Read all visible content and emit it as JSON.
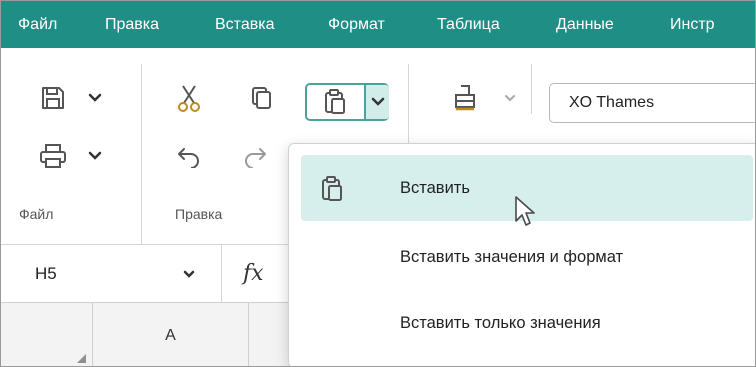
{
  "menubar": {
    "items": [
      "Файл",
      "Правка",
      "Вставка",
      "Формат",
      "Таблица",
      "Данные",
      "Инстр"
    ]
  },
  "toolbar": {
    "groups": {
      "file": "Файл",
      "edit": "Правка"
    },
    "font_name": "XO Thames"
  },
  "formula_bar": {
    "cell_reference": "H5",
    "fx_label": "fx"
  },
  "grid": {
    "column_headers": [
      "A"
    ]
  },
  "paste_menu": {
    "items": [
      {
        "label": "Вставить",
        "icon": "paste-icon",
        "highlighted": true
      },
      {
        "label": "Вставить значения и формат"
      },
      {
        "label": "Вставить только значения"
      }
    ]
  },
  "colors": {
    "menubar_bg": "#1f8f86",
    "accent": "#4aa39a",
    "highlight": "#d6efed"
  }
}
